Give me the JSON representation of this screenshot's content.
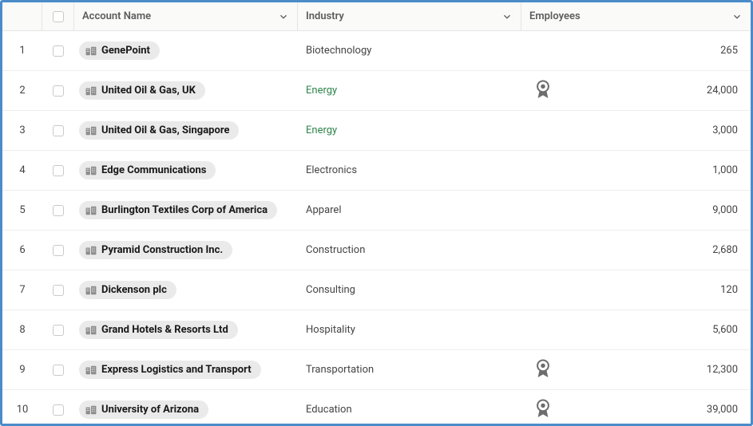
{
  "columns": {
    "account_name": "Account Name",
    "industry": "Industry",
    "employees": "Employees"
  },
  "rows": [
    {
      "num": "1",
      "name": "GenePoint",
      "industry": "Biotechnology",
      "industry_type": "normal",
      "employees": "265",
      "award": false
    },
    {
      "num": "2",
      "name": "United Oil & Gas, UK",
      "industry": "Energy",
      "industry_type": "energy",
      "employees": "24,000",
      "award": true
    },
    {
      "num": "3",
      "name": "United Oil & Gas, Singapore",
      "industry": "Energy",
      "industry_type": "energy",
      "employees": "3,000",
      "award": false
    },
    {
      "num": "4",
      "name": "Edge Communications",
      "industry": "Electronics",
      "industry_type": "normal",
      "employees": "1,000",
      "award": false
    },
    {
      "num": "5",
      "name": "Burlington Textiles Corp of America",
      "industry": "Apparel",
      "industry_type": "normal",
      "employees": "9,000",
      "award": false
    },
    {
      "num": "6",
      "name": "Pyramid Construction Inc.",
      "industry": "Construction",
      "industry_type": "normal",
      "employees": "2,680",
      "award": false
    },
    {
      "num": "7",
      "name": "Dickenson plc",
      "industry": "Consulting",
      "industry_type": "normal",
      "employees": "120",
      "award": false
    },
    {
      "num": "8",
      "name": "Grand Hotels & Resorts Ltd",
      "industry": "Hospitality",
      "industry_type": "normal",
      "employees": "5,600",
      "award": false
    },
    {
      "num": "9",
      "name": "Express Logistics and Transport",
      "industry": "Transportation",
      "industry_type": "normal",
      "employees": "12,300",
      "award": true
    },
    {
      "num": "10",
      "name": "University of Arizona",
      "industry": "Education",
      "industry_type": "normal",
      "employees": "39,000",
      "award": true
    }
  ]
}
